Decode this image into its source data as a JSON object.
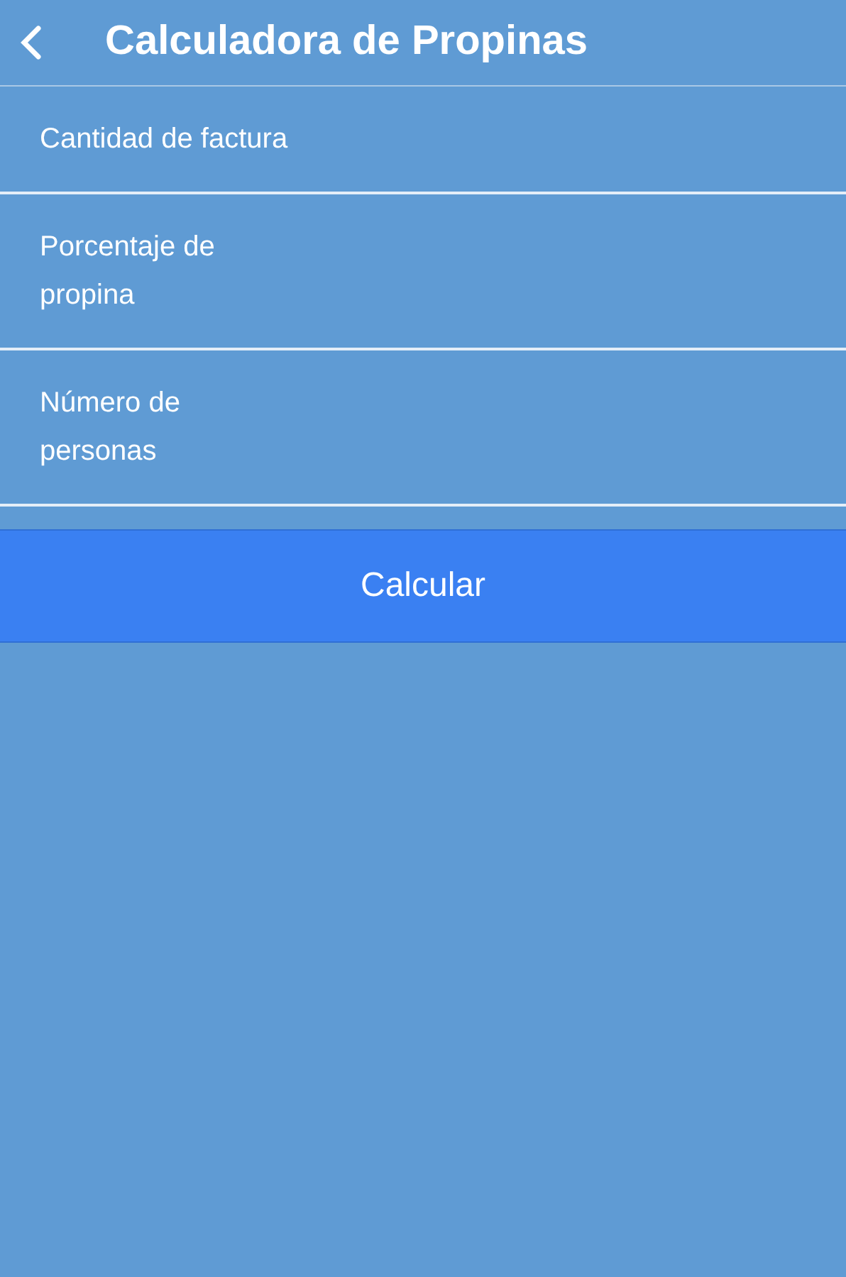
{
  "header": {
    "title": "Calculadora de Propinas"
  },
  "fields": [
    {
      "label": "Cantidad de factura"
    },
    {
      "label": "Porcentaje de propina"
    },
    {
      "label": "Número de personas"
    }
  ],
  "button": {
    "label": "Calcular"
  }
}
